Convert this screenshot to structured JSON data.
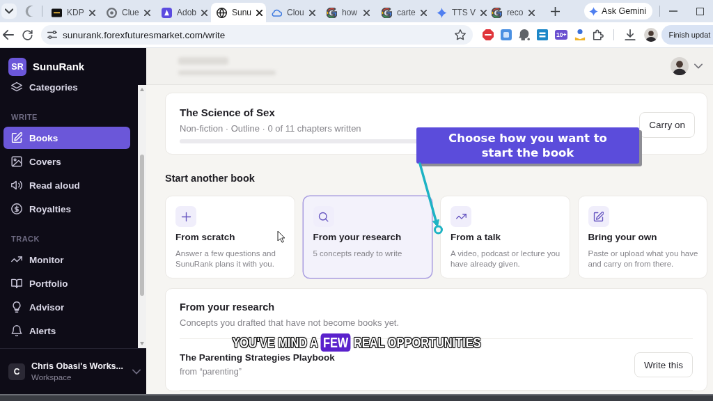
{
  "browser": {
    "tabs": [
      {
        "title": "KDP",
        "selected": false
      },
      {
        "title": "Clue",
        "selected": false
      },
      {
        "title": "Adob",
        "selected": false
      },
      {
        "title": "Sunu",
        "selected": true
      },
      {
        "title": "Clou",
        "selected": false
      },
      {
        "title": "how",
        "selected": false
      },
      {
        "title": "carte",
        "selected": false
      },
      {
        "title": "TTS V",
        "selected": false
      },
      {
        "title": "reco",
        "selected": false
      }
    ],
    "gemini_button": "Ask Gemini",
    "address": "sunurank.forexfuturesmarket.com/write",
    "extension_badge": "10+",
    "update_button": "Finish updat"
  },
  "sidebar": {
    "logo": "SR",
    "brand": "SunuRank",
    "sections": [
      {
        "items": [
          {
            "label": "Categories",
            "selected": false
          }
        ]
      },
      {
        "heading": "WRITE",
        "items": [
          {
            "label": "Books",
            "selected": true
          },
          {
            "label": "Covers",
            "selected": false
          },
          {
            "label": "Read aloud",
            "selected": false
          },
          {
            "label": "Royalties",
            "selected": false
          }
        ]
      },
      {
        "heading": "TRACK",
        "items": [
          {
            "label": "Monitor",
            "selected": false
          },
          {
            "label": "Portfolio",
            "selected": false
          },
          {
            "label": "Advisor",
            "selected": false
          },
          {
            "label": "Alerts",
            "selected": false
          }
        ]
      }
    ],
    "workspace": {
      "initial": "C",
      "name": "Chris Obasi's Works...",
      "role": "Workspace"
    }
  },
  "current_book": {
    "title": "The Science of Sex",
    "meta": "Non-fiction · Outline · 0 of 11 chapters written",
    "button": "Carry on"
  },
  "start_another": {
    "heading": "Start another book",
    "options": [
      {
        "title": "From scratch",
        "description": "Answer a few questions and SunuRank plans it with you.",
        "selected": false
      },
      {
        "title": "From your research",
        "description": "5 concepts ready to write",
        "selected": true
      },
      {
        "title": "From a talk",
        "description": "A video, podcast or lecture you have already given.",
        "selected": false
      },
      {
        "title": "Bring your own",
        "description": "Paste or upload what you have and carry on from there.",
        "selected": false
      }
    ]
  },
  "research": {
    "heading": "From your research",
    "subtitle": "Concepts you drafted that have not become books yet.",
    "concepts": [
      {
        "title": "The Parenting Strategies Playbook",
        "source": "from “parenting”",
        "button": "Write this"
      }
    ]
  },
  "callout": {
    "text": "Choose how you want to start the book"
  },
  "caption": {
    "words": [
      {
        "text": "YOU'VE",
        "highlighted": false
      },
      {
        "text": "MIND",
        "highlighted": false
      },
      {
        "text": "A",
        "highlighted": false
      },
      {
        "text": "FEW",
        "highlighted": true
      },
      {
        "text": "REAL",
        "highlighted": false
      },
      {
        "text": "OPPORTUNITIES",
        "highlighted": false
      }
    ]
  }
}
